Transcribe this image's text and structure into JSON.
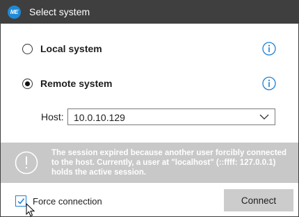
{
  "app": {
    "logo_text": "ME",
    "window_title": "Select system"
  },
  "options": [
    {
      "label": "Local system",
      "selected": false
    },
    {
      "label": "Remote system",
      "selected": true
    }
  ],
  "host": {
    "label": "Host:",
    "value": "10.0.10.129"
  },
  "banner": {
    "message": "The session expired because another user forcibly connected to the host. Currently, a user at \"localhost\" (::ffff: 127.0.0.1) holds the active session."
  },
  "footer": {
    "force_label": "Force connection",
    "force_checked": true,
    "connect_label": "Connect"
  },
  "colors": {
    "titlebar": "#3f3f3f",
    "accent": "#1f7fd4",
    "banner": "#c8c8c8",
    "button": "#cccccc"
  }
}
